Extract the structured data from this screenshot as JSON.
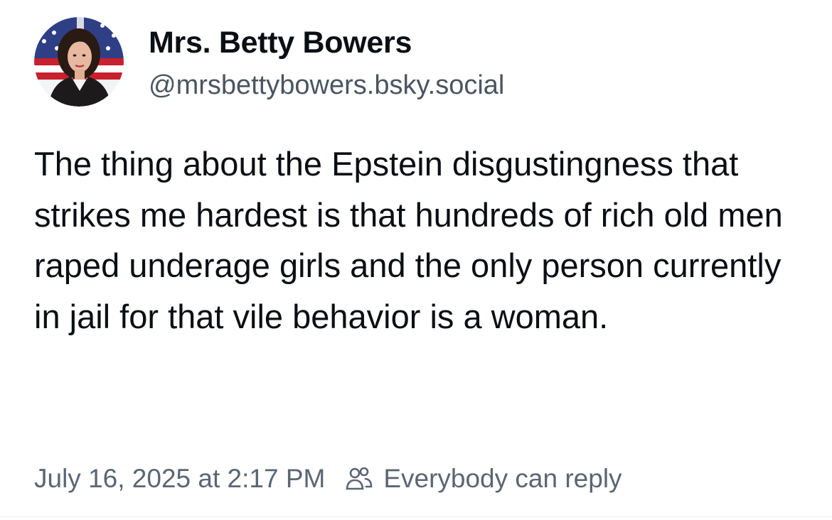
{
  "post": {
    "author": {
      "display_name": "Mrs. Betty Bowers",
      "handle": "@mrsbettybowers.bsky.social",
      "avatar_icon": "portrait-avatar-icon"
    },
    "text": "The thing about the Epstein disgustingness that strikes me hardest is that hundreds of rich old men raped underage girls and the only person currently in jail for that vile behavior is a woman.",
    "timestamp": "July 16, 2025 at 2:17 PM",
    "reply_setting": {
      "label": "Everybody can reply",
      "icon": "people-icon"
    }
  },
  "colors": {
    "text_primary": "#0b0f14",
    "text_secondary": "#5b6673",
    "background": "#ffffff"
  }
}
